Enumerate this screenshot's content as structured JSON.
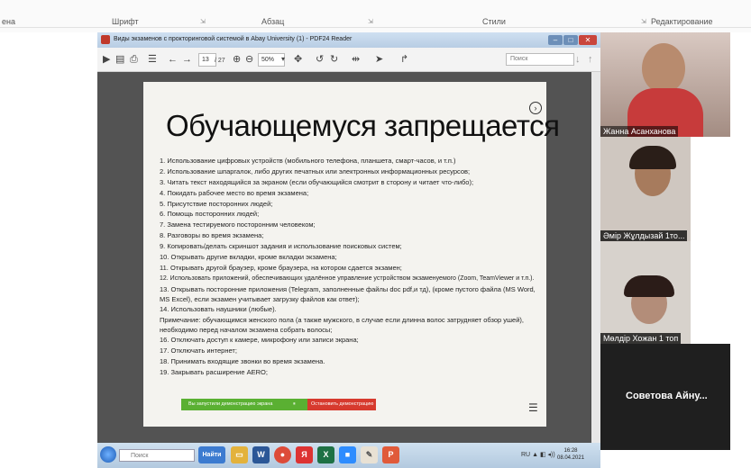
{
  "ribbon": {
    "tab_left": "ена",
    "groups": [
      "Шрифт",
      "Абзац",
      "Стили",
      "Редактирование"
    ]
  },
  "pdf": {
    "window_title": "Виды экзаменов  с прокторинговой системой в Abay University (1) - PDF24 Reader",
    "page_current": "13",
    "page_total": "/ 27",
    "zoom": "50%",
    "search_placeholder": "Поиск",
    "heading": "Обучающемуся запрещается",
    "rules": [
      "1. Использование цифровых устройств (мобильного телефона, планшета, смарт-часов,  и т.п.)",
      "2. Использование шпаргалок, либо других печатных или электронных информационных ресурсов;",
      "3. Читать текст находящийся за экраном (если обучающийся смотрит в сторону и читает что-либо);",
      "4. Покидать рабочее место во время экзамена;",
      "5. Присутствие посторонних людей;",
      "6. Помощь посторонних людей;",
      "7. Замена тестируемого посторонним человеком;",
      "8. Разговоры во время экзамена;",
      "9. Копировать/делать скриншот задания и использование поисковых систем;",
      "10. Открывать другие вкладки, кроме вкладки экзамена;",
      "11. Открывать другой браузер, кроме браузера, на котором сдается экзамен;",
      "12. Использовать приложений, обеспечивающих удалённое управление устройством экзаменуемого (Zoom, TeamViewer и т.п.).",
      "13. Открывать посторонние приложения (Telegram, заполненные файлы doc pdf,и тд), (кроме пустого файла (MS Word, MS Excel), если экзамен учитывает загрузку файлов как ответ);",
      "14. Использовать наушники (любые).",
      "Примечание: обучающимся женского пола (а также мужского, в случае если длинна волос затрудняет обзор ушей), необходимо перед началом экзамена собрать волосы;",
      "16. Отключать доступ к камере, микрофону или записи экрана;",
      "17. Отключать интернет;",
      "18. Принимать входящие звонки во время экзамена.",
      "19. Закрывать расширение AERO;"
    ],
    "share_bar": {
      "status": "Вы запустили демонстрацию экрана",
      "stop": "Остановить демонстрацию"
    }
  },
  "participants": [
    {
      "name": "Жанна Асанханова"
    },
    {
      "name": "Әмір Жұлдызай 1то..."
    },
    {
      "name": "Мөлдір Хожан  1 топ"
    },
    {
      "name": "Советова  Айну..."
    }
  ],
  "taskbar": {
    "search_placeholder": "Поиск",
    "lang": "RU",
    "time": "16:28",
    "date": "08.04.2021",
    "apps": [
      "Найти",
      "W",
      "Chrome",
      "Яндекс",
      "Excel",
      "Zoom",
      "Paint",
      "PDF"
    ]
  },
  "colors": {
    "share_green": "#5ab032",
    "share_red": "#d73a2e",
    "doc_background": "#535353"
  }
}
